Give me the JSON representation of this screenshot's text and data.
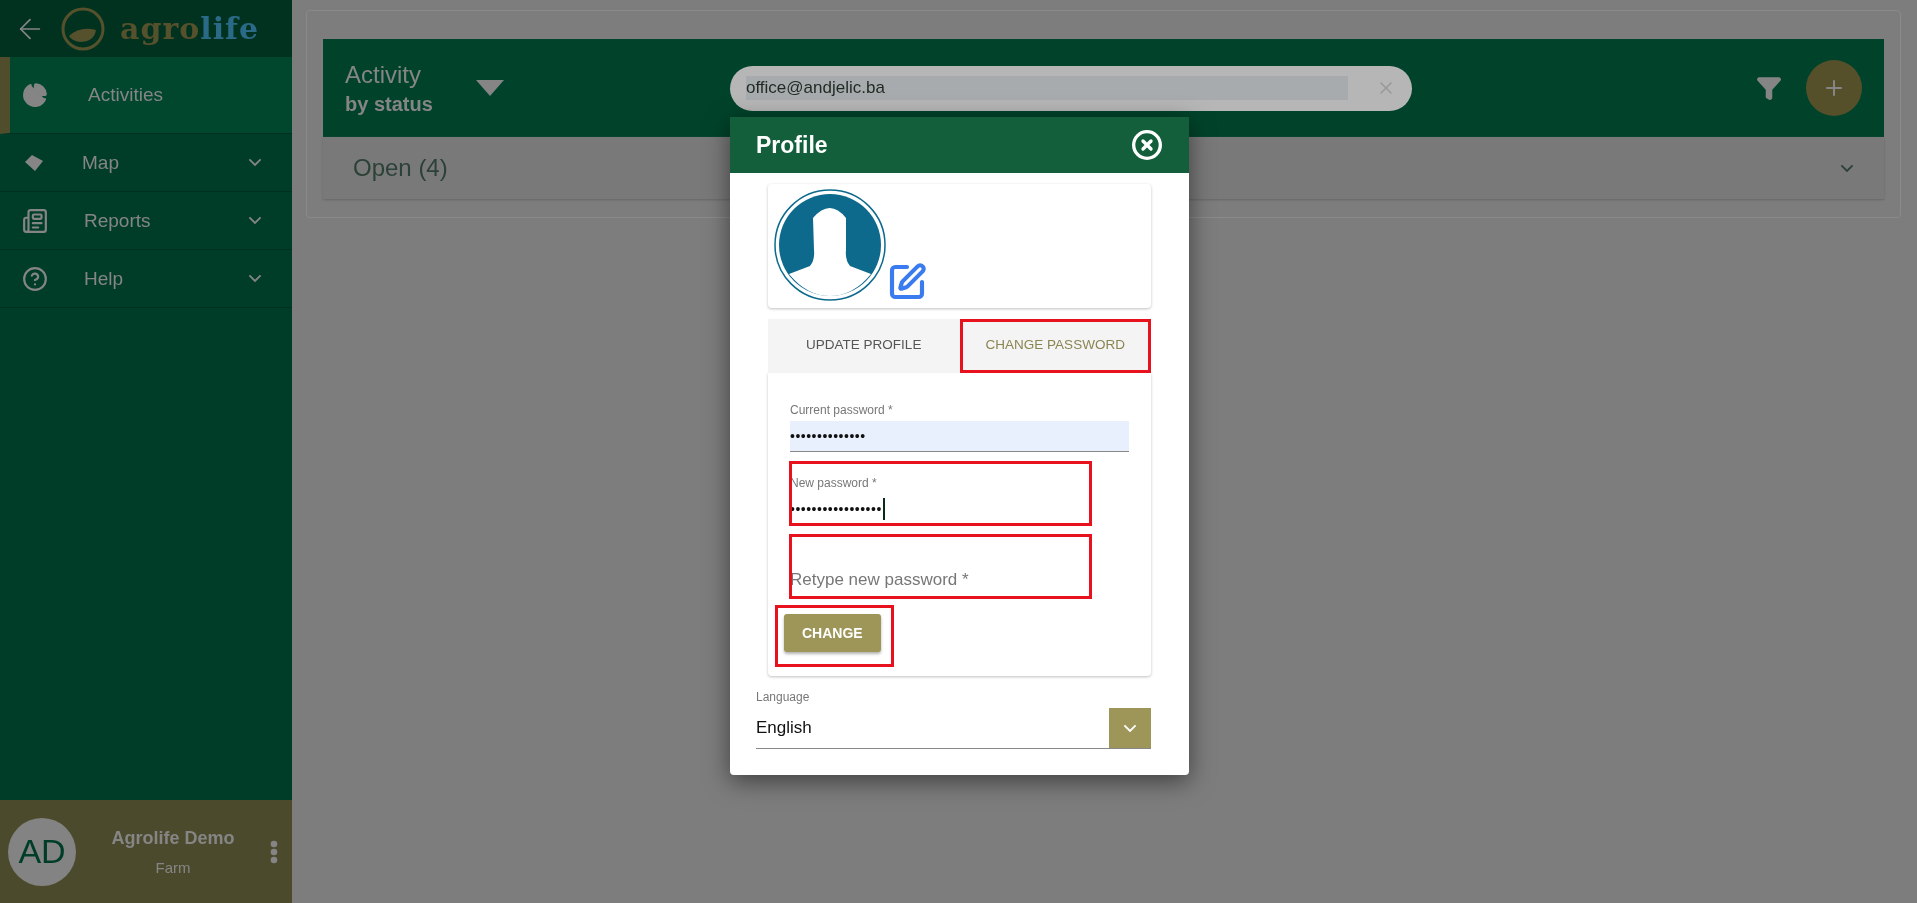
{
  "sidebar": {
    "logo": {
      "part_1": "agro",
      "part_2": "life"
    },
    "nav": [
      {
        "label": "Activities",
        "selected": true,
        "expandable": false
      },
      {
        "label": "Map",
        "selected": false,
        "expandable": true,
        "kind": "map"
      },
      {
        "label": "Reports",
        "selected": false,
        "expandable": true,
        "kind": "reports"
      },
      {
        "label": "Help",
        "selected": false,
        "expandable": true,
        "kind": "help"
      }
    ],
    "user": {
      "initials": "AD",
      "name": "Agrolife Demo",
      "role": "Farm"
    }
  },
  "header": {
    "title": "Activity",
    "subtitle": "by status",
    "search_value": "office@andjelic.ba"
  },
  "groups": [
    {
      "label": "Open (4)",
      "expanded": false
    }
  ],
  "dialog": {
    "title": "Profile",
    "tabs": [
      {
        "label": "UPDATE PROFILE",
        "selected": false,
        "highlighted": false
      },
      {
        "label": "CHANGE PASSWORD",
        "selected": true,
        "highlighted": true
      }
    ],
    "fields": [
      {
        "label": "Current password *",
        "value": "••••••••••••••",
        "autofilled": true,
        "focused": false,
        "highlighted": false
      },
      {
        "label": "New password *",
        "value": "•••••••••••••••••",
        "autofilled": false,
        "focused": true,
        "highlighted": true
      },
      {
        "placeholder": "Retype new password *",
        "autofilled": false,
        "focused": false,
        "highlighted": true
      }
    ],
    "submit": {
      "label": "CHANGE",
      "highlighted": true
    },
    "language": {
      "label": "Language",
      "value": "English"
    }
  }
}
